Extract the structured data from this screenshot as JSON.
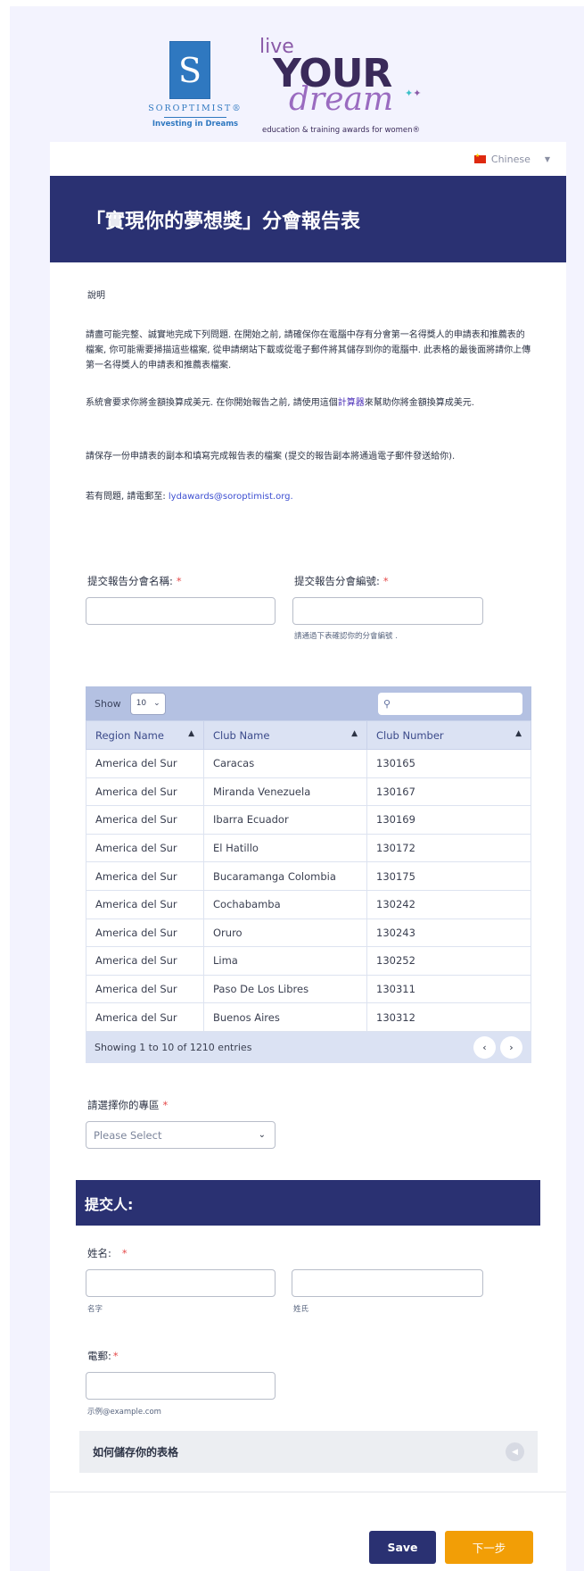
{
  "logos": {
    "soroptimist_name": "SOROPTIMIST®",
    "soroptimist_tagline": "Investing in Dreams",
    "lyd_live": "live",
    "lyd_your": "YOUR",
    "lyd_dream": "dream",
    "lyd_tagline": "education & training awards for women®"
  },
  "language": {
    "selected": "Chinese"
  },
  "header": {
    "title": "「實現你的夢想獎」分會報告表"
  },
  "intro": {
    "heading": "說明",
    "p1": "請盡可能完整、誠實地完成下列問題. 在開始之前, 請確保你在電腦中存有分會第一名得獎人的申請表和推薦表的檔案, 你可能需要掃描這些檔案, 從申請網站下載或從電子郵件將其儲存到你的電腦中. 此表格的最後面將請你上傳第一名得獎人的申請表和推薦表檔案.",
    "p2_before": "系統會要求你將金額換算成美元. 在你開始報告之前, 請使用這個",
    "p2_link": "計算器",
    "p2_after": "來幫助你將金額換算成美元.",
    "p3": "請保存一份申請表的副本和填寫完成報告表的檔案 (提交的報告副本將通過電子郵件發送給你).",
    "p4_before": "若有問題, 請電郵至: ",
    "p4_email": "lydawards@soroptimist.org",
    "p4_after": "."
  },
  "club_fields": {
    "name_label": "提交報告分會名稱:",
    "number_label": "提交報告分會編號:",
    "number_hint": "請通過下表確認你的分會編號 ."
  },
  "table": {
    "show_label": "Show",
    "page_size": "10",
    "columns": [
      "Region Name",
      "Club Name",
      "Club Number"
    ],
    "rows": [
      [
        "America del Sur",
        "Caracas",
        "130165"
      ],
      [
        "America del Sur",
        "Miranda Venezuela",
        "130167"
      ],
      [
        "America del Sur",
        "Ibarra Ecuador",
        "130169"
      ],
      [
        "America del Sur",
        "El Hatillo",
        "130172"
      ],
      [
        "America del Sur",
        "Bucaramanga Colombia",
        "130175"
      ],
      [
        "America del Sur",
        "Cochabamba",
        "130242"
      ],
      [
        "America del Sur",
        "Oruro",
        "130243"
      ],
      [
        "America del Sur",
        "Lima",
        "130252"
      ],
      [
        "America del Sur",
        "Paso De Los Libres",
        "130311"
      ],
      [
        "America del Sur",
        "Buenos Aires",
        "130312"
      ]
    ],
    "footer": "Showing 1 to 10 of 1210 entries"
  },
  "region": {
    "label": "請選擇你的專區",
    "placeholder": "Please Select"
  },
  "submitter": {
    "title": "提交人:",
    "name_label": "姓名:",
    "first_hint": "名字",
    "last_hint": "姓氏",
    "email_label": "電郵:",
    "email_hint": "示例@example.com"
  },
  "howto": {
    "label": "如何儲存你的表格"
  },
  "buttons": {
    "save": "Save",
    "next": "下一步"
  },
  "required_mark": "*"
}
